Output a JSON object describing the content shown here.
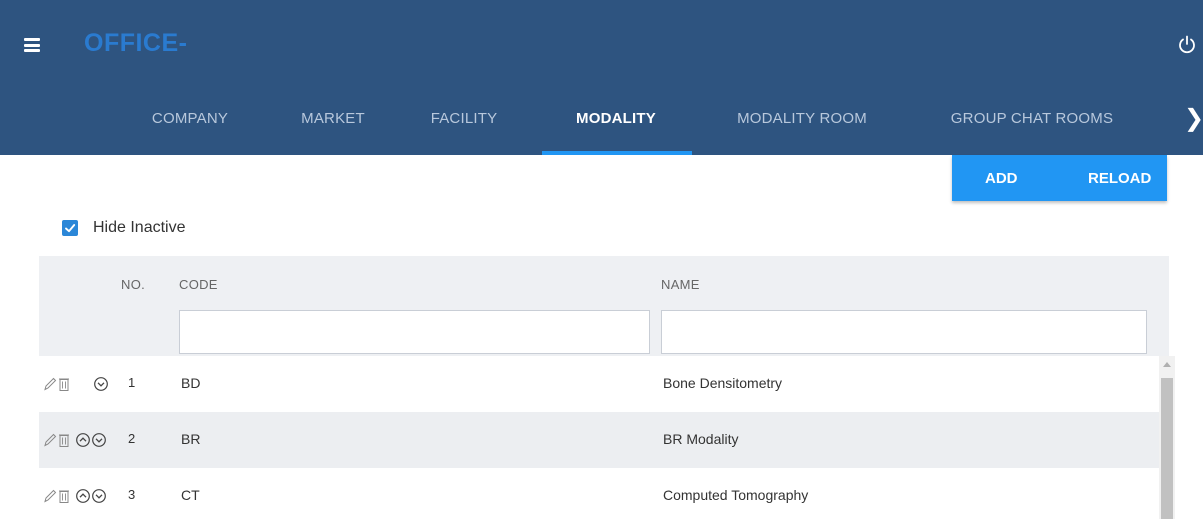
{
  "header": {
    "title": "OFFICE-"
  },
  "tabs": [
    {
      "label": "COMPANY"
    },
    {
      "label": "MARKET"
    },
    {
      "label": "FACILITY"
    },
    {
      "label": "MODALITY",
      "active": true
    },
    {
      "label": "MODALITY ROOM"
    },
    {
      "label": "GROUP CHAT ROOMS"
    }
  ],
  "tabs_next_glyph": "❯",
  "actions": {
    "add_label": "ADD",
    "reload_label": "RELOAD"
  },
  "filter": {
    "hide_inactive_label": "Hide Inactive",
    "hide_inactive_checked": true
  },
  "grid": {
    "columns": {
      "no": "NO.",
      "code": "CODE",
      "name": "NAME"
    },
    "code_filter_value": "",
    "name_filter_value": "",
    "rows": [
      {
        "no": "1",
        "code": "BD",
        "name": "Bone Densitometry"
      },
      {
        "no": "2",
        "code": "BR",
        "name": "BR Modality"
      },
      {
        "no": "3",
        "code": "CT",
        "name": "Computed Tomography"
      }
    ]
  },
  "colors": {
    "header_bg": "#2e5480",
    "title": "#2a7bd0",
    "accent": "#2196f3",
    "tab_inactive": "#b8c8dc"
  }
}
